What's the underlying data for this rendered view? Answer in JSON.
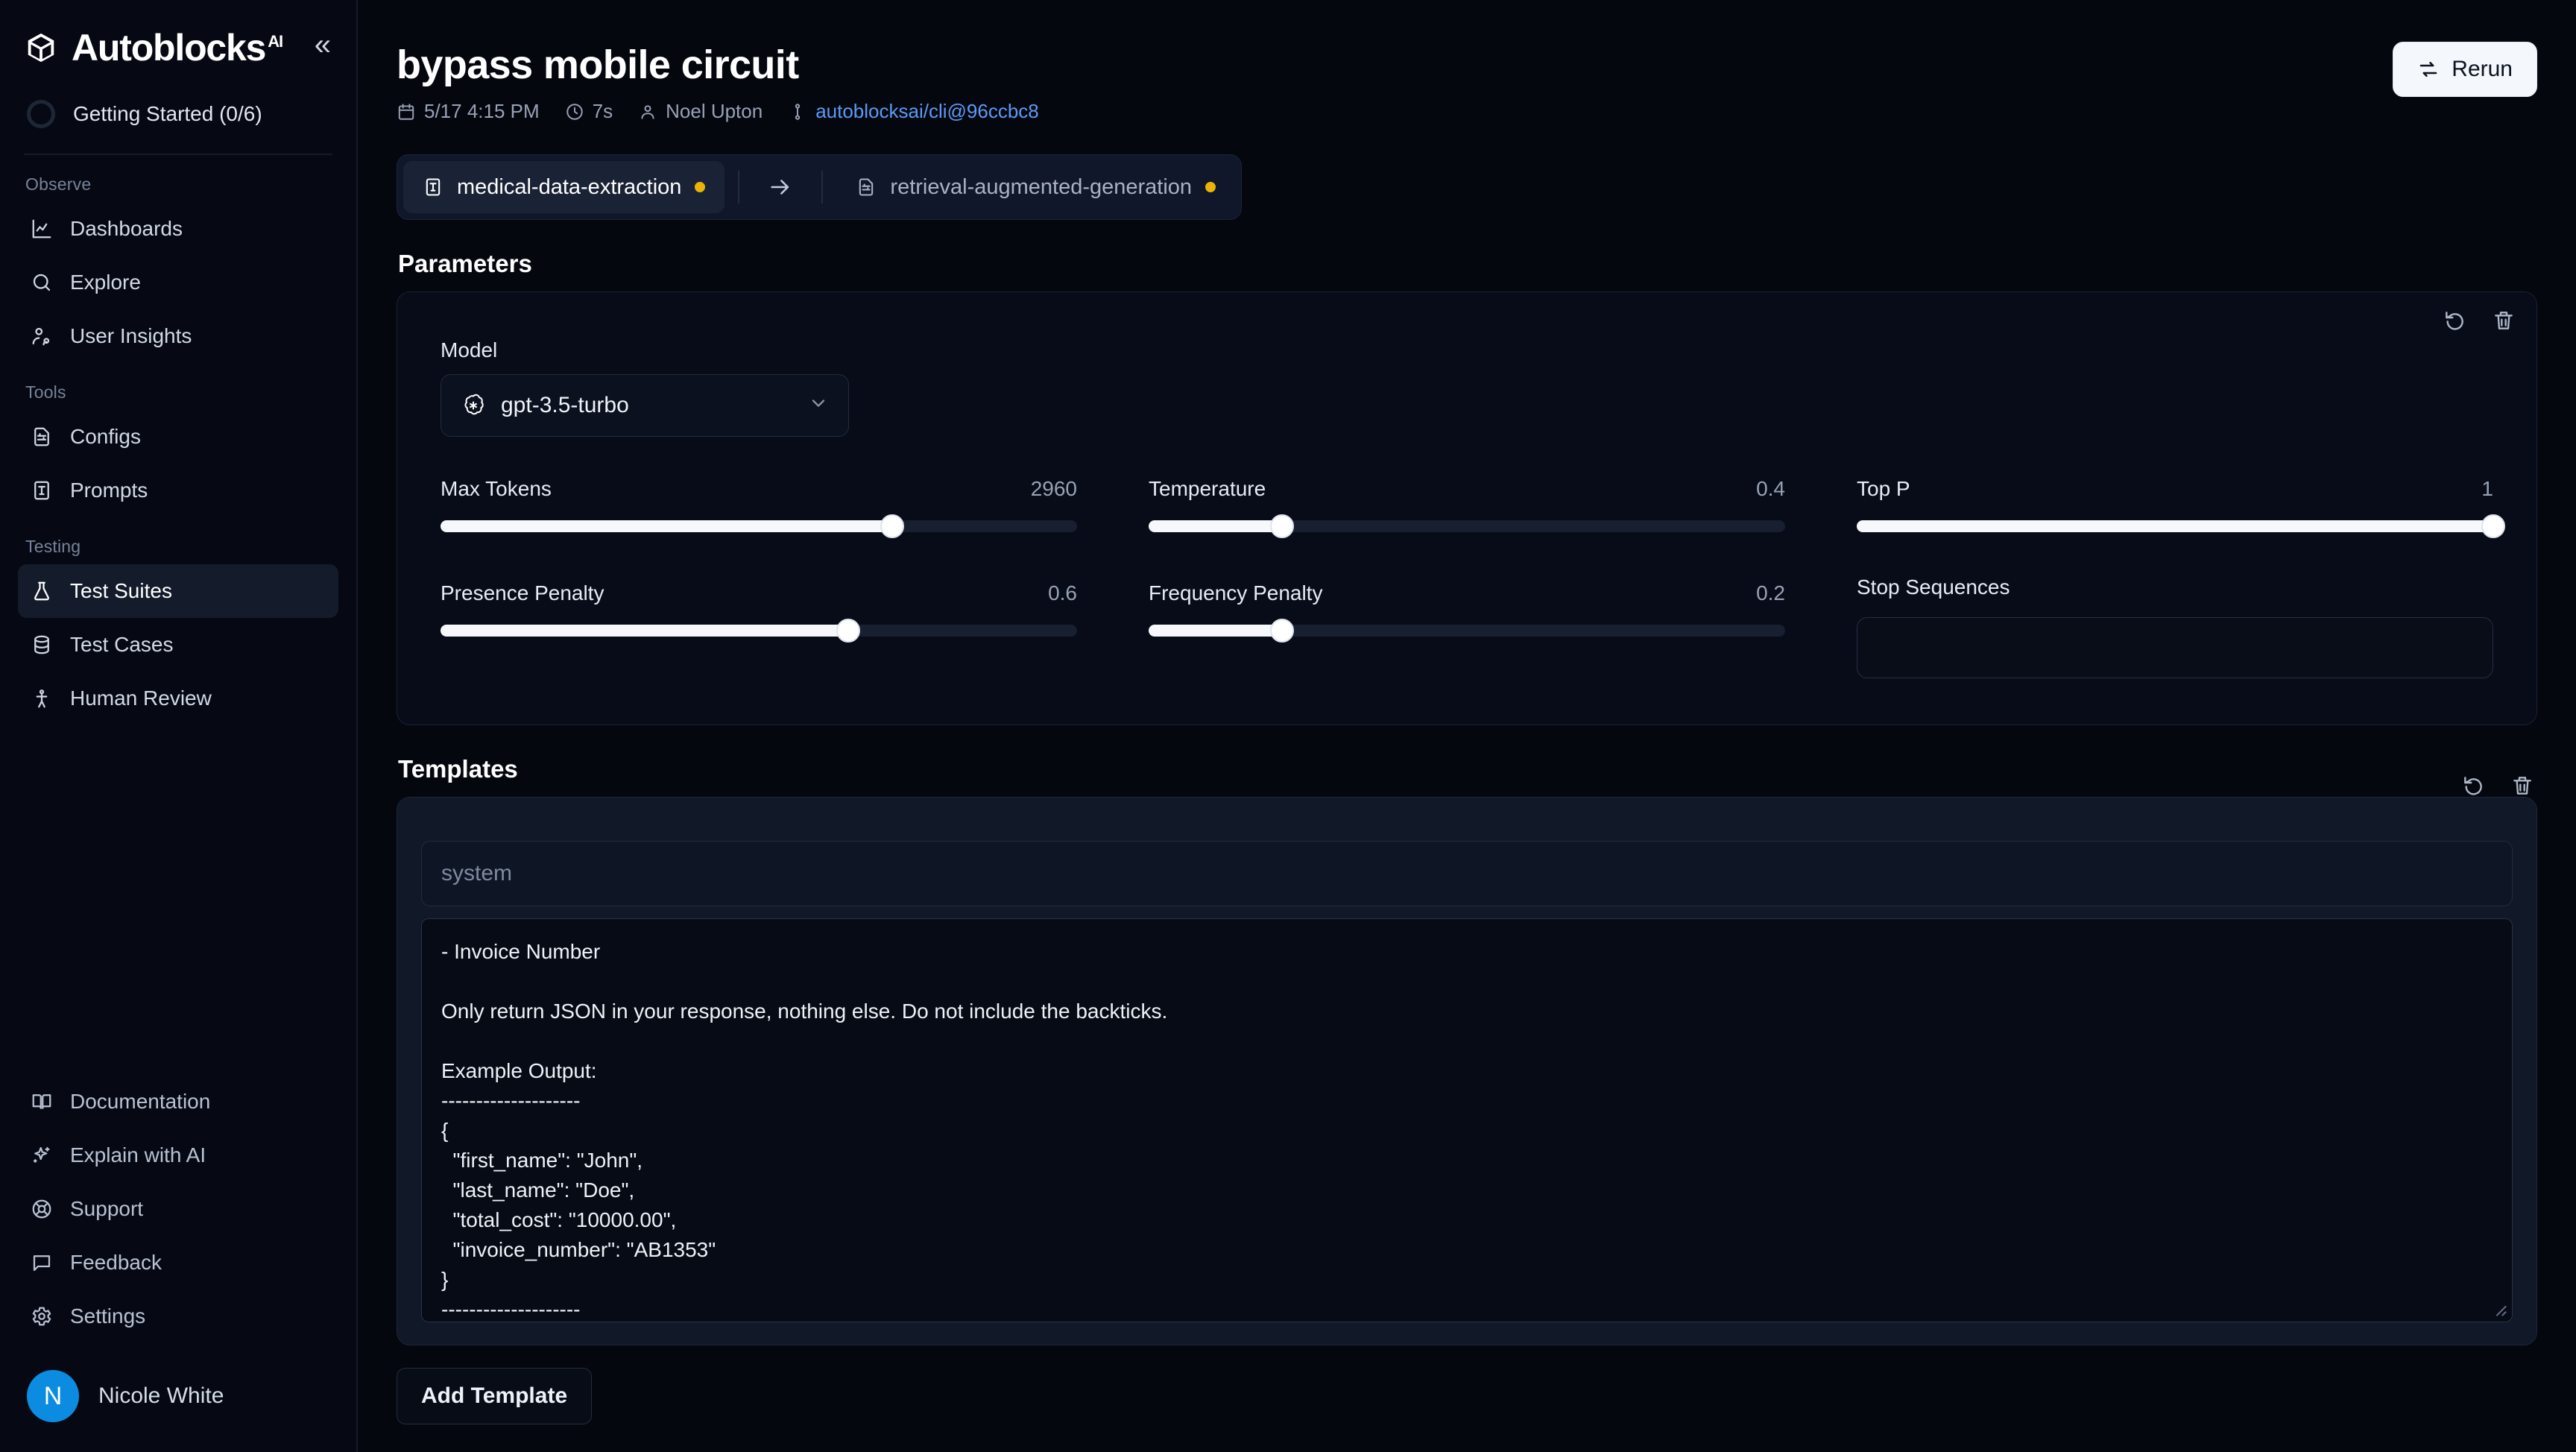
{
  "sidebar": {
    "brand": {
      "name": "Autoblocks",
      "superscript": "AI",
      "logo_icon": "autoblocks-cube-icon",
      "collapse_icon": "double-chevron-left-icon"
    },
    "getting_started": {
      "label": "Getting Started (0/6)",
      "icon": "progress-ring-icon"
    },
    "sections": [
      {
        "header": "Observe",
        "items": [
          {
            "label": "Dashboards",
            "icon": "line-chart-icon",
            "active": false
          },
          {
            "label": "Explore",
            "icon": "search-icon",
            "active": false
          },
          {
            "label": "User Insights",
            "icon": "users-icon",
            "active": false
          }
        ]
      },
      {
        "header": "Tools",
        "items": [
          {
            "label": "Configs",
            "icon": "file-sliders-icon",
            "active": false
          },
          {
            "label": "Prompts",
            "icon": "text-document-icon",
            "active": false
          }
        ]
      },
      {
        "header": "Testing",
        "items": [
          {
            "label": "Test Suites",
            "icon": "flask-icon",
            "active": true
          },
          {
            "label": "Test Cases",
            "icon": "database-icon",
            "active": false
          },
          {
            "label": "Human Review",
            "icon": "person-icon",
            "active": false
          }
        ]
      }
    ],
    "bottom_items": [
      {
        "label": "Documentation",
        "icon": "book-icon"
      },
      {
        "label": "Explain with AI",
        "icon": "sparkles-icon"
      },
      {
        "label": "Support",
        "icon": "life-buoy-icon"
      },
      {
        "label": "Feedback",
        "icon": "message-square-icon"
      },
      {
        "label": "Settings",
        "icon": "gear-icon"
      }
    ],
    "user": {
      "initial": "N",
      "name": "Nicole White",
      "avatar_color": "#0c8ce1"
    }
  },
  "header": {
    "title": "bypass mobile circuit",
    "meta": {
      "date": "5/17 4:15 PM",
      "duration": "7s",
      "author": "Noel Upton",
      "branch": "autoblocksai/cli@96ccbc8",
      "date_icon": "calendar-icon",
      "duration_icon": "clock-icon",
      "author_icon": "user-icon",
      "branch_icon": "git-branch-icon",
      "link_color": "#5a9bf6"
    },
    "rerun": {
      "label": "Rerun",
      "icon": "rerun-arrows-icon"
    }
  },
  "chips": [
    {
      "label": "medical-data-extraction",
      "icon": "text-document-icon",
      "dot_color": "#eab308",
      "active": true
    },
    {
      "label": "retrieval-augmented-generation",
      "icon": "file-sliders-icon",
      "dot_color": "#eab308",
      "active": false
    }
  ],
  "chip_arrow_icon": "arrow-right-icon",
  "parameters": {
    "section_title": "Parameters",
    "actions": [
      {
        "icon": "undo-icon",
        "name": "reset"
      },
      {
        "icon": "trash-icon",
        "name": "delete"
      }
    ],
    "model": {
      "label": "Model",
      "value": "gpt-3.5-turbo",
      "icon": "openai-icon",
      "chevron": "chevron-down-icon"
    },
    "sliders": [
      {
        "label": "Max Tokens",
        "value": "2960",
        "percent": 71
      },
      {
        "label": "Temperature",
        "value": "0.4",
        "percent": 21
      },
      {
        "label": "Top P",
        "value": "1",
        "percent": 100
      },
      {
        "label": "Presence Penalty",
        "value": "0.6",
        "percent": 64
      },
      {
        "label": "Frequency Penalty",
        "value": "0.2",
        "percent": 21
      }
    ],
    "stop_sequences": {
      "label": "Stop Sequences",
      "value": ""
    }
  },
  "templates": {
    "section_title": "Templates",
    "actions": [
      {
        "icon": "undo-icon",
        "name": "reset"
      },
      {
        "icon": "trash-icon",
        "name": "delete"
      }
    ],
    "name_placeholder": "system",
    "name_value": "",
    "body": "- Invoice Number\n\nOnly return JSON in your response, nothing else. Do not include the backticks.\n\nExample Output:\n--------------------\n{\n  \"first_name\": \"John\",\n  \"last_name\": \"Doe\",\n  \"total_cost\": \"10000.00\",\n  \"invoice_number\": \"AB1353\"\n}\n--------------------",
    "add_button": "Add Template"
  }
}
